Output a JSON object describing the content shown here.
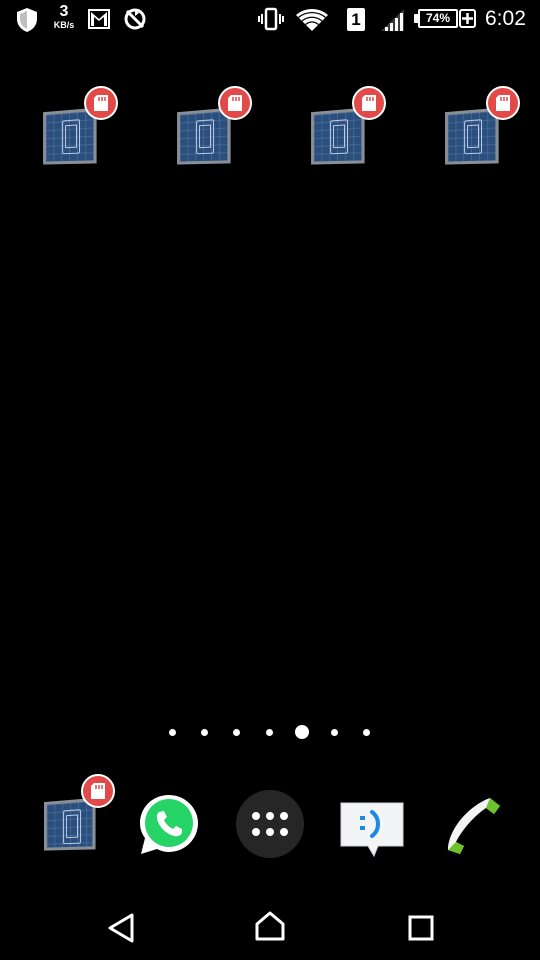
{
  "status_bar": {
    "data_speed_value": "3",
    "data_speed_unit": "KB/s",
    "sim_slot": "1",
    "battery_percent": "74%",
    "battery_level": 0.74,
    "time": "6:02",
    "icons": [
      "shield-icon",
      "gmail-icon",
      "sync-off-icon",
      "vibrate-icon",
      "wifi-icon",
      "sim-1-icon",
      "signal-icon",
      "battery-icon",
      "charging-icon"
    ]
  },
  "home_screen": {
    "shortcuts": [
      {
        "icon": "blueprint-app-icon",
        "badge": "sd-card-icon"
      },
      {
        "icon": "blueprint-app-icon",
        "badge": "sd-card-icon"
      },
      {
        "icon": "blueprint-app-icon",
        "badge": "sd-card-icon"
      },
      {
        "icon": "blueprint-app-icon",
        "badge": "sd-card-icon"
      }
    ],
    "page_indicator": {
      "total": 7,
      "current": 5
    }
  },
  "dock": {
    "items": [
      "blueprint-app-icon",
      "whatsapp-icon",
      "apps-drawer-icon",
      "messaging-icon",
      "phone-icon"
    ]
  },
  "nav_bar": {
    "items": [
      "back-icon",
      "home-icon",
      "recents-icon"
    ]
  },
  "colors": {
    "background": "#000000",
    "badge_red": "#e24a4a",
    "whatsapp_green": "#25d366",
    "phone_green": "#6cc22b",
    "messaging_blue": "#1e88e5",
    "blueprint_blue": "#2b4f7d"
  }
}
